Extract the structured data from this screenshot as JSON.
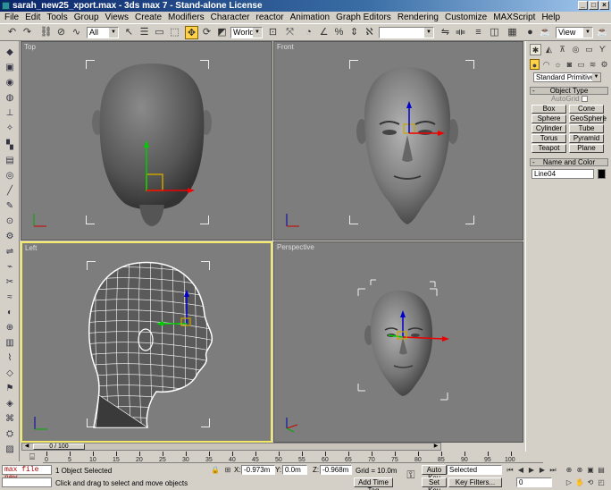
{
  "window": {
    "title": "sarah_new25_xport.max - 3ds max 7 - Stand-alone License",
    "min": "_",
    "max": "□",
    "close": "×"
  },
  "menu": [
    "File",
    "Edit",
    "Tools",
    "Group",
    "Views",
    "Create",
    "Modifiers",
    "Character",
    "reactor",
    "Animation",
    "Graph Editors",
    "Rendering",
    "Customize",
    "MAXScript",
    "Help"
  ],
  "toolbar": {
    "selection_filter": "All",
    "ref_coord": "World",
    "named_selection": "",
    "view_combo": "View"
  },
  "viewports": {
    "top": "Top",
    "front": "Front",
    "left": "Left",
    "perspective": "Perspective"
  },
  "command_panel": {
    "category": "Standard Primitives",
    "object_type_title": "Object Type",
    "autogrid": "AutoGrid",
    "primitives": [
      "Box",
      "Cone",
      "Sphere",
      "GeoSphere",
      "Cylinder",
      "Tube",
      "Torus",
      "Pyramid",
      "Teapot",
      "Plane"
    ],
    "name_color_title": "Name and Color",
    "object_name": "Line04",
    "object_color": "#000000"
  },
  "timeline": {
    "frame": "0 / 100",
    "ticks": [
      "0",
      "5",
      "10",
      "15",
      "20",
      "25",
      "30",
      "35",
      "40",
      "45",
      "50",
      "55",
      "60",
      "65",
      "70",
      "75",
      "80",
      "85",
      "90",
      "95",
      "100"
    ]
  },
  "status": {
    "maxscript": "max file new",
    "selection": "1 Object Selected",
    "prompt": "Click and drag to select and move objects",
    "x_label": "X:",
    "x": "-0.973m",
    "y_label": "Y:",
    "y": "0.0m",
    "z_label": "Z:",
    "z": "-0.968m",
    "grid": "Grid = 10.0m",
    "add_time_tag": "Add Time Tag",
    "auto_key": "Auto Key",
    "set_key": "Set Key",
    "key_mode": "Selected",
    "key_filters": "Key Filters...",
    "current_frame": "0"
  }
}
